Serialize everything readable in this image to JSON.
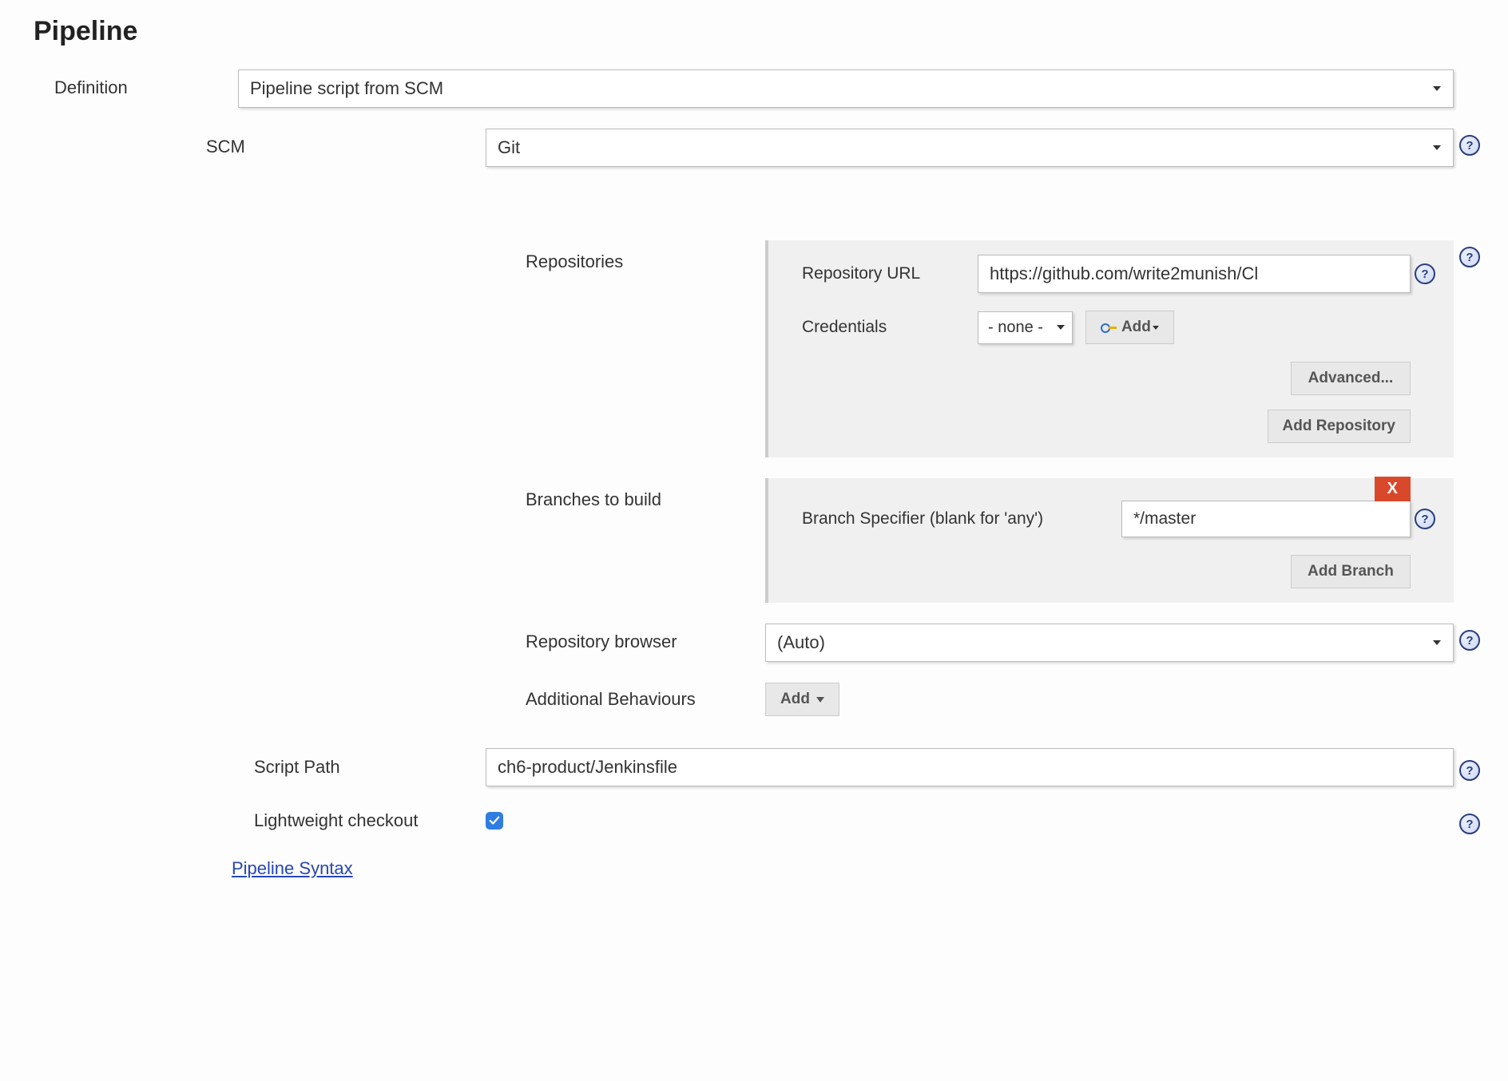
{
  "section_title": "Pipeline",
  "definition": {
    "label": "Definition",
    "value": "Pipeline script from SCM"
  },
  "scm": {
    "label": "SCM",
    "value": "Git"
  },
  "repositories": {
    "label": "Repositories",
    "repo_url_label": "Repository URL",
    "repo_url_value": "https://github.com/write2munish/Cl",
    "credentials_label": "Credentials",
    "credentials_value": "- none -",
    "add_credentials_label": "Add",
    "advanced_button": "Advanced...",
    "add_repository_button": "Add Repository"
  },
  "branches": {
    "label": "Branches to build",
    "specifier_label": "Branch Specifier (blank for 'any')",
    "specifier_value": "*/master",
    "add_branch_button": "Add Branch",
    "delete_label": "X"
  },
  "repo_browser": {
    "label": "Repository browser",
    "value": "(Auto)"
  },
  "additional_behaviours": {
    "label": "Additional Behaviours",
    "add_label": "Add"
  },
  "script_path": {
    "label": "Script Path",
    "value": "ch6-product/Jenkinsfile"
  },
  "lightweight": {
    "label": "Lightweight checkout",
    "checked": true
  },
  "pipeline_syntax_link": "Pipeline Syntax",
  "help_text": "?"
}
